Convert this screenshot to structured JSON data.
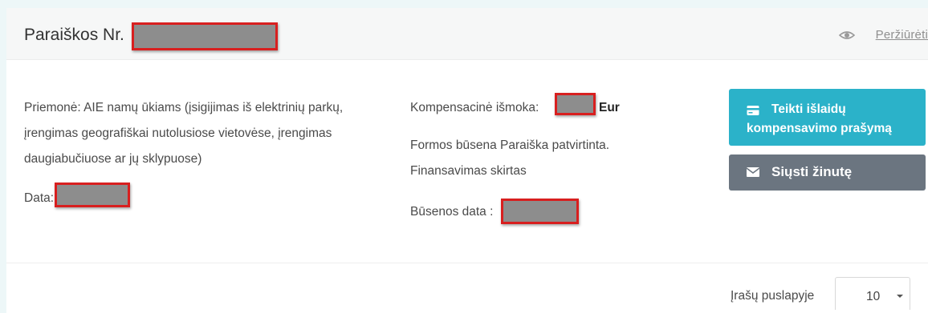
{
  "header": {
    "title": "Paraiškos Nr.",
    "preview_link": "Peržiūrėti",
    "preview_icon": "eye-icon"
  },
  "details": {
    "measure_lines": [
      "Priemonė: AIE namų ūkiams (įsigijimas iš elektrinių parkų,",
      "įrengimas geografiškai nutolusiose vietovėse, įrengimas",
      "daugiabučiuose ar jų sklypuose)"
    ],
    "date_label": "Data:",
    "compensation_label": "Kompensacinė išmoka:",
    "currency": "Eur",
    "form_status_line1": "Formos būsena Paraiška patvirtinta.",
    "form_status_line2": "Finansavimas skirtas",
    "status_date_label": "Būsenos data :"
  },
  "actions": {
    "submit_line1": "Teikti išlaidų",
    "submit_line2": "kompensavimo prašymą",
    "submit_icon": "credit-card-icon",
    "message_label": "Siųsti žinutę",
    "message_icon": "envelope-icon"
  },
  "pagination": {
    "per_page_label": "Įrašų puslapyje",
    "per_page_value": "10"
  },
  "colors": {
    "teal_button": "#2bb2c9",
    "gray_button": "#6b7580",
    "redaction_border": "#d81f1f",
    "redaction_fill": "#8d8d8d"
  }
}
